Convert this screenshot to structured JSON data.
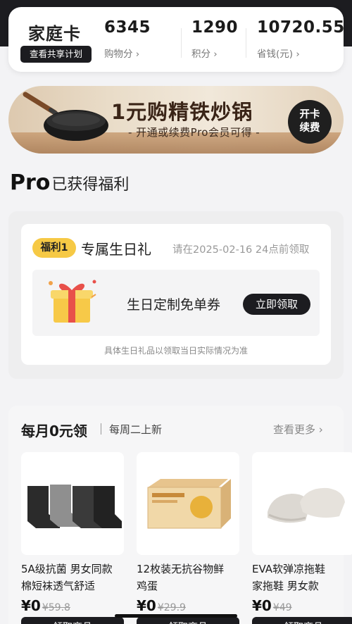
{
  "stats": {
    "title": "家庭卡",
    "share_plan_label": "查看共享计划",
    "items": [
      {
        "value": "6345",
        "label": "购物分"
      },
      {
        "value": "1290",
        "label": "积分"
      },
      {
        "value": "10720.55",
        "label": "省钱(元)"
      }
    ]
  },
  "banner": {
    "headline": "1元购精铁炒锅",
    "subline": "- 开通或续费Pro会员可得 -",
    "button_line1": "开卡",
    "button_line2": "续费"
  },
  "section": {
    "pro": "Pro",
    "title_rest": "已获得福利"
  },
  "benefit": {
    "tag": "福利1",
    "name": "专属生日礼",
    "deadline": "请在2025-02-16 24点前领取",
    "coupon_name": "生日定制免单券",
    "claim_label": "立即领取",
    "note": "具体生日礼品以领取当日实际情况为准"
  },
  "monthly": {
    "title": "每月0元领",
    "subtitle": "每周二上新",
    "see_more": "查看更多",
    "products": [
      {
        "name_line1": "5A级抗菌 男女同款",
        "name_line2": "棉短袜透气舒适",
        "price": "¥0",
        "old_price": "¥59.8",
        "button": "领取商品"
      },
      {
        "name_line1": "12枚装无抗谷物鲜",
        "name_line2": "鸡蛋",
        "price": "¥0",
        "old_price": "¥29.9",
        "button": "领取商品"
      },
      {
        "name_line1": "EVA软弹凉拖鞋",
        "name_line2": "家拖鞋 男女款",
        "price": "¥0",
        "old_price": "¥49",
        "button": "领取商品"
      }
    ]
  },
  "colors": {
    "dark": "#1c1c20",
    "accent_yellow": "#f6c945",
    "muted": "#999999"
  }
}
